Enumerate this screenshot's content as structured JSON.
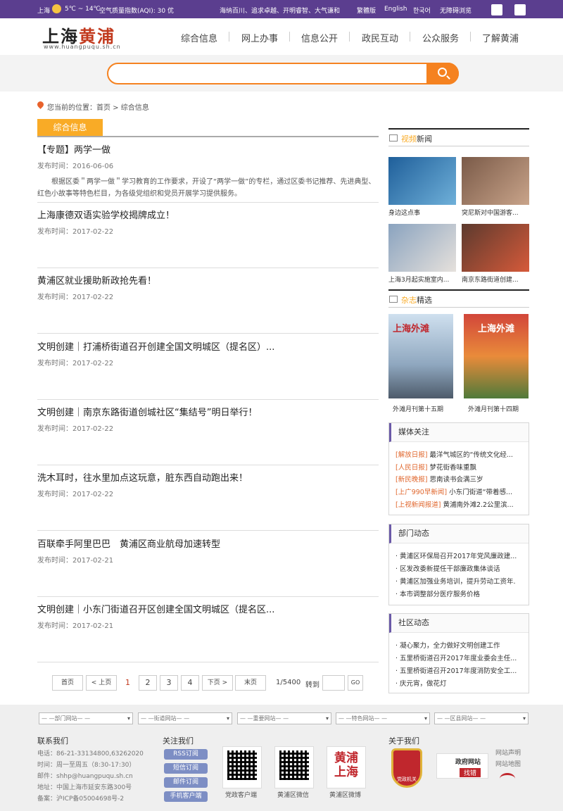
{
  "topbar": {
    "city": "上海",
    "weather": "5℃ ~ 14℃",
    "aqi": "空气质量指数(AQI): 30 优",
    "slogan": "海纳百川、追求卓越、开明睿智、大气谦和",
    "lang_trad": "繁體版",
    "lang_en": "English",
    "lang_kr": "한국어",
    "accessible": "无障碍浏览"
  },
  "logo": {
    "text1": "上海",
    "text2": "黄浦",
    "sub": "www.huangpuqu.sh.cn"
  },
  "nav": [
    "综合信息",
    "网上办事",
    "信息公开",
    "政民互动",
    "公众服务",
    "了解黄浦"
  ],
  "breadcrumb": "您当前的位置：首页 > 综合信息",
  "tab": "综合信息",
  "articles": [
    {
      "title": "【专题】两学一做",
      "date": "发布时间：2016-06-06",
      "summary": "根据区委＂两学一做＂学习教育的工作要求，开设了“两学一做”的专栏，通过区委书记推荐、先进典型、红色小故事等特色栏目，为各级党组织和党员开展学习提供服务。"
    },
    {
      "title": "上海康德双语实验学校揭牌成立！",
      "date": "发布时间：2017-02-22"
    },
    {
      "title": "黄浦区就业援助新政抢先看！",
      "date": "发布时间：2017-02-22"
    },
    {
      "title": "文明创建｜打浦桥街道召开创建全国文明城区（提名区）...",
      "date": "发布时间：2017-02-22"
    },
    {
      "title": "文明创建｜南京东路街道创城社区“集结号”明日举行！",
      "date": "发布时间：2017-02-22"
    },
    {
      "title": "洗木耳时，往水里加点这玩意，脏东西自动跑出来！",
      "date": "发布时间：2017-02-22"
    },
    {
      "title": "百联牵手阿里巴巴　黄浦区商业航母加速转型",
      "date": "发布时间：2017-02-21"
    },
    {
      "title": "文明创建｜小东门街道召开区创建全国文明城区（提名区...",
      "date": "发布时间：2017-02-21"
    }
  ],
  "pager": {
    "first": "首页",
    "prev": "< 上页",
    "p1": "1",
    "p2": "2",
    "p3": "3",
    "p4": "4",
    "next": "下页 >",
    "last": "末页",
    "total": "1/5400",
    "goto": "转到",
    "go": "GO"
  },
  "video": {
    "title_o": "视频",
    "title": "新闻",
    "items": [
      "身边这点事",
      "突尼斯对中国游客...",
      "上海3月起实施室内...",
      "南京东路街道创建..."
    ]
  },
  "mag": {
    "title_o": "杂志",
    "title": "精选",
    "items": [
      "外滩月刊第十五期",
      "外滩月刊第十四期"
    ],
    "cover": "上海外滩"
  },
  "media": {
    "title": "媒体关注",
    "items": [
      {
        "src": "[解放日报]",
        "t": "最洋气城区的“传统文化经..."
      },
      {
        "src": "[人民日报]",
        "t": "梦花街香味重飘"
      },
      {
        "src": "[新民晚报]",
        "t": "思南读书会满三岁"
      },
      {
        "src": "[上广990早新闻]",
        "t": "小东门街道“带着感..."
      },
      {
        "src": "[上视新闻报道]",
        "t": "黄浦南外滩2.2公里滨..."
      }
    ]
  },
  "dept": {
    "title": "部门动态",
    "items": [
      "黄浦区环保局召开2017年党风廉政建...",
      "区发改委新提任干部廉政集体谈话",
      "黄浦区加强业务培训，提升劳动工资年.",
      "本市调整部分医疗服务价格"
    ]
  },
  "community": {
    "title": "社区动态",
    "items": [
      "凝心聚力，全力做好文明创建工作",
      "五里桥街道召开2017年度业委会主任...",
      "五里桥街道召开2017年度消防安全工...",
      "庆元宵，做花灯"
    ]
  },
  "footer": {
    "selects": [
      "— —部门网站— —",
      "— —街道网站— —",
      "— —重要网站— —",
      "— —特色网站— —",
      "— —区县网站— —"
    ],
    "contact_title": "联系我们",
    "contact": [
      "电话：86-21-33134800,63262020",
      "时间：周一至周五（8:30-17:30）",
      "邮件：shhp@huangpuqu.sh.cn",
      "地址：中国上海市延安东路300号",
      "备案：沪ICP备05004698号-2"
    ],
    "follow_title": "关注我们",
    "follow_btns": [
      "RSS订阅",
      "短信订阅",
      "邮件订阅",
      "手机客户端"
    ],
    "qr": [
      "党政客户端",
      "黄浦区微信",
      "黄浦区微博"
    ],
    "weibo_text": "黄浦上海",
    "about_title": "关于我们",
    "badge1": "党政机关",
    "badge2a": "政府网站",
    "badge2b": "找错",
    "links": [
      "网站声明",
      "网站地图"
    ]
  }
}
